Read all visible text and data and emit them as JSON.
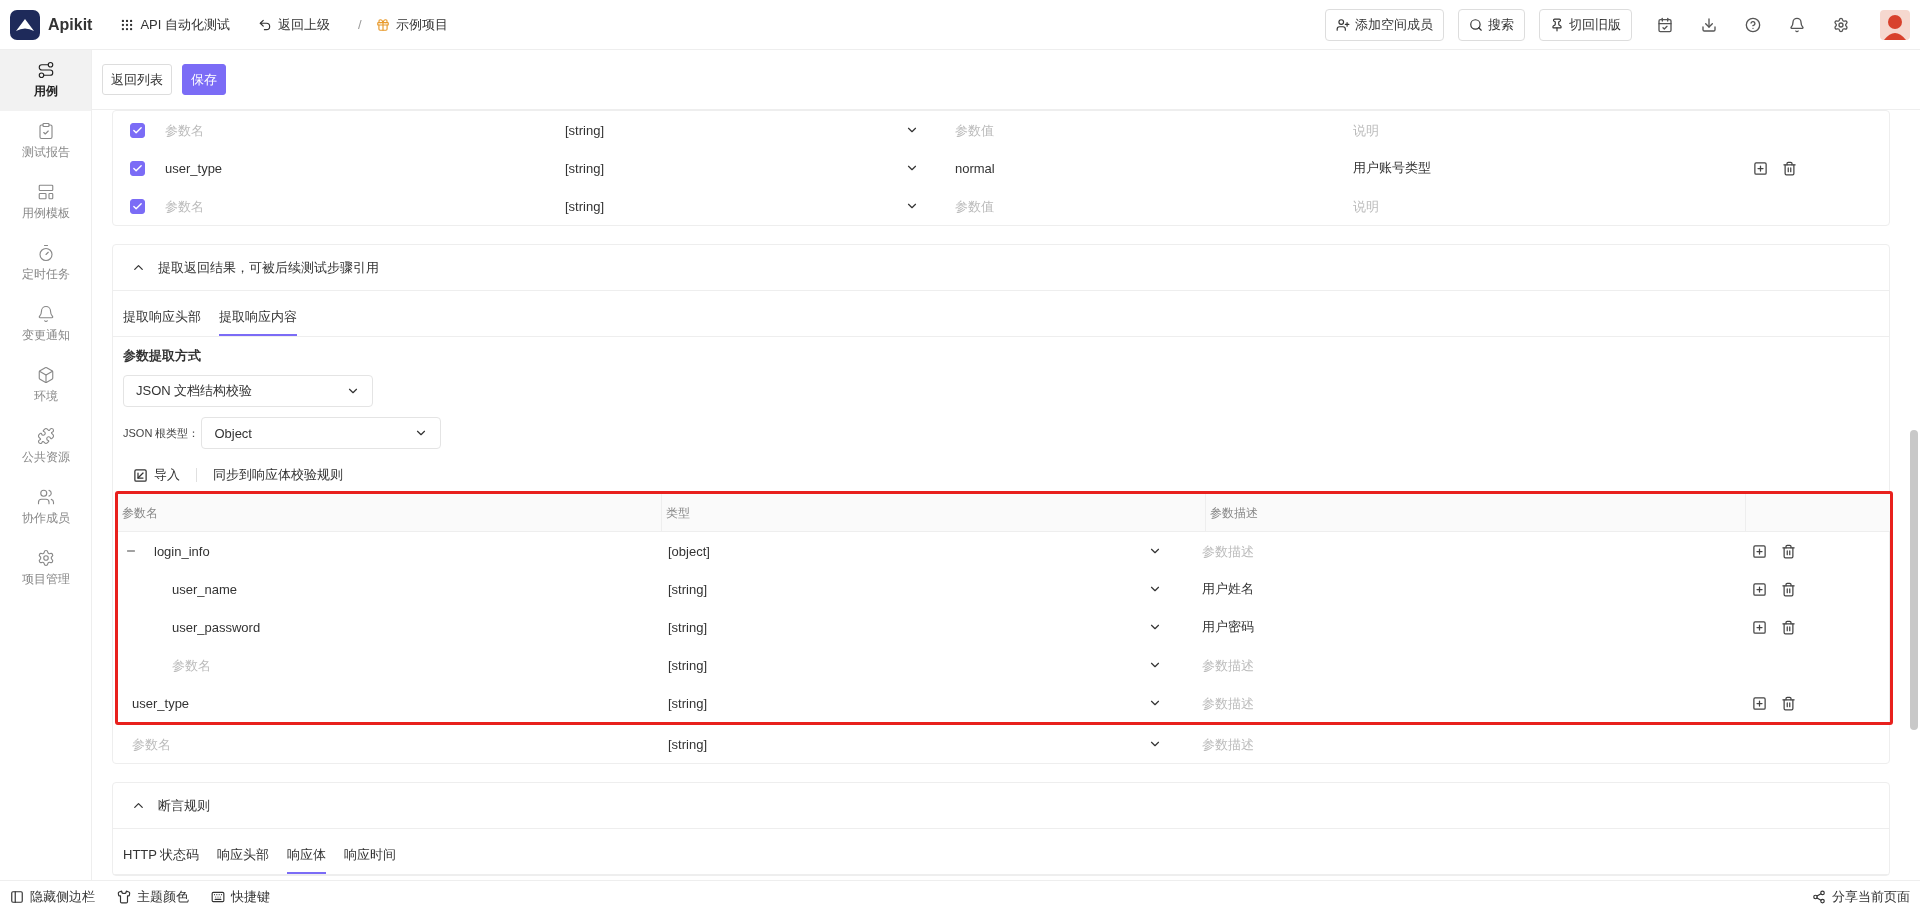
{
  "header": {
    "logo": "Apikit",
    "app_menu": "API 自动化测试",
    "back": "返回上级",
    "separator": "/",
    "project": "示例项目",
    "actions": [
      {
        "label": "添加空间成员",
        "kind": "invite"
      },
      {
        "label": "搜索",
        "kind": "search"
      },
      {
        "label": "切回旧版",
        "kind": "switch"
      }
    ]
  },
  "sidebar": {
    "items": [
      {
        "label": "用例",
        "kind": "cases",
        "selected": true
      },
      {
        "label": "测试报告",
        "kind": "report",
        "selected": false
      },
      {
        "label": "用例模板",
        "kind": "template",
        "selected": false
      },
      {
        "label": "定时任务",
        "kind": "timer",
        "selected": false
      },
      {
        "label": "变更通知",
        "kind": "bell",
        "selected": false
      },
      {
        "label": "环境",
        "kind": "cube",
        "selected": false
      },
      {
        "label": "公共资源",
        "kind": "puzzle",
        "selected": false
      },
      {
        "label": "协作成员",
        "kind": "users",
        "selected": false
      },
      {
        "label": "项目管理",
        "kind": "gear",
        "selected": false
      }
    ]
  },
  "toolbar": {
    "buttons": [
      {
        "label": "返回列表",
        "kind": "default"
      },
      {
        "label": "保存",
        "kind": "primary"
      }
    ]
  },
  "params_table": {
    "rows": [
      {
        "checked": true,
        "name": {
          "placeholder": "参数名"
        },
        "type": "[string]",
        "value": {
          "placeholder": "参数值"
        },
        "description": {
          "placeholder": "说明"
        },
        "actions": false
      },
      {
        "checked": true,
        "name": {
          "value": "user_type"
        },
        "type": "[string]",
        "value": {
          "value": "normal"
        },
        "description": {
          "value": "用户账号类型"
        },
        "actions": true
      },
      {
        "checked": true,
        "name": {
          "placeholder": "参数名"
        },
        "type": "[string]",
        "value": {
          "placeholder": "参数值"
        },
        "description": {
          "placeholder": "说明"
        },
        "actions": false
      }
    ]
  },
  "extract": {
    "title": "提取返回结果，可被后续测试步骤引用",
    "expanded": true,
    "tabs": [
      {
        "label": "提取响应头部",
        "selected": false
      },
      {
        "label": "提取响应内容",
        "selected": true
      }
    ],
    "method_label": "参数提取方式",
    "method": "JSON 文档结构校验",
    "root_type_label": "JSON 根类型：",
    "root_type": "Object",
    "tools": [
      {
        "label": "导入",
        "kind": "import"
      },
      {
        "label": "同步到响应体校验规则",
        "kind": "text"
      }
    ],
    "schema_table": {
      "highlighted": true,
      "columns": [
        "参数名",
        "类型",
        "参数描述"
      ],
      "rows": [
        {
          "name": {
            "value": "login_info"
          },
          "type": "[object]",
          "description": {
            "placeholder": "参数描述"
          },
          "actions": true,
          "expanded": true,
          "children": [
            {
              "name": {
                "value": "user_name"
              },
              "type": "[string]",
              "description": {
                "value": "用户姓名"
              },
              "actions": true
            },
            {
              "name": {
                "value": "user_password"
              },
              "type": "[string]",
              "description": {
                "value": "用户密码"
              },
              "actions": true
            },
            {
              "name": {
                "placeholder": "参数名"
              },
              "type": "[string]",
              "description": {
                "placeholder": "参数描述"
              },
              "actions": false
            }
          ]
        },
        {
          "name": {
            "value": "user_type"
          },
          "type": "[string]",
          "description": {
            "placeholder": "参数描述"
          },
          "actions": true
        }
      ],
      "trailing_rows": [
        {
          "name": {
            "placeholder": "参数名"
          },
          "type": "[string]",
          "description": {
            "placeholder": "参数描述"
          },
          "actions": false
        }
      ]
    }
  },
  "assertions": {
    "title": "断言规则",
    "expanded": true,
    "tabs": [
      {
        "label": "HTTP 状态码",
        "selected": false
      },
      {
        "label": "响应头部",
        "selected": false
      },
      {
        "label": "响应体",
        "selected": true
      },
      {
        "label": "响应时间",
        "selected": false
      }
    ]
  },
  "footer": {
    "items": [
      {
        "label": "隐藏侧边栏",
        "kind": "sidebar"
      },
      {
        "label": "主题颜色",
        "kind": "shirt"
      },
      {
        "label": "快捷键",
        "kind": "keyboard"
      }
    ],
    "share": "分享当前页面"
  }
}
